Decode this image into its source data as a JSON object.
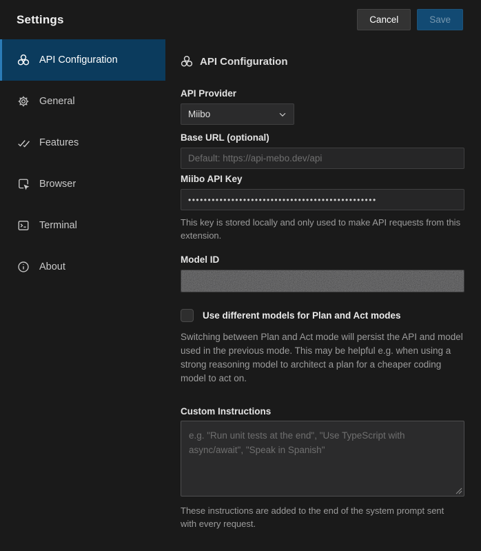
{
  "colors": {
    "page-bg": "#1a1a1a",
    "active-bg": "#0b3b5d",
    "accent": "#2b7cb8",
    "save-bg": "#124a73"
  },
  "header": {
    "title": "Settings",
    "cancel_label": "Cancel",
    "save_label": "Save"
  },
  "sidebar": {
    "items": [
      {
        "label": "API Configuration",
        "icon": "api-icon",
        "active": true
      },
      {
        "label": "General",
        "icon": "gear-icon",
        "active": false
      },
      {
        "label": "Features",
        "icon": "double-check-icon",
        "active": false
      },
      {
        "label": "Browser",
        "icon": "browser-inspect-icon",
        "active": false
      },
      {
        "label": "Terminal",
        "icon": "terminal-icon",
        "active": false
      },
      {
        "label": "About",
        "icon": "info-icon",
        "active": false
      }
    ]
  },
  "main": {
    "section_title": "API Configuration",
    "section_icon": "api-icon",
    "api_provider": {
      "label": "API Provider",
      "selected": "Miibo"
    },
    "base_url": {
      "label": "Base URL (optional)",
      "value": "",
      "placeholder": "Default: https://api-mebo.dev/api"
    },
    "api_key": {
      "label": "Miibo API Key",
      "masked_value": "••••••••••••••••••••••••••••••••••••••••••••••••",
      "help": "This key is stored locally and only used to make API requests from this extension."
    },
    "model_id": {
      "label": "Model ID",
      "value_state": "redacted"
    },
    "plan_act": {
      "label": "Use different models for Plan and Act modes",
      "checked": false,
      "help": "Switching between Plan and Act mode will persist the API and model used in the previous mode. This may be helpful e.g. when using a strong reasoning model to architect a plan for a cheaper coding model to act on."
    },
    "custom_instructions": {
      "label": "Custom Instructions",
      "value": "",
      "placeholder": "e.g. \"Run unit tests at the end\", \"Use TypeScript with async/await\", \"Speak in Spanish\"",
      "help": "These instructions are added to the end of the system prompt sent with every request."
    }
  }
}
